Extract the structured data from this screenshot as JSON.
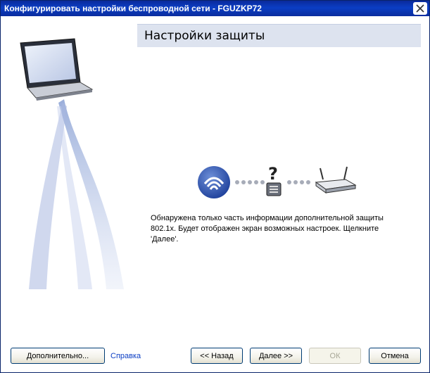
{
  "window": {
    "title": "Конфигурировать настройки беспроводной сети - FGUZKP72"
  },
  "header": {
    "title": "Настройки защиты"
  },
  "message": {
    "text": "Обнаружена только часть информации дополнительной защиты 802.1x. Будет отображен экран возможных настроек. Щелкните 'Далее'."
  },
  "buttons": {
    "advanced": "Дополнительно...",
    "help": "Справка",
    "back": "<< Назад",
    "next": "Далее >>",
    "ok": "ОК",
    "cancel": "Отмена"
  },
  "icons": {
    "close": "close-icon",
    "laptop": "laptop-icon",
    "wireless": "wireless-icon",
    "lock_question": "unknown-security-icon",
    "router": "router-icon"
  },
  "colors": {
    "titlebar": "#0a2a9c",
    "header_band": "#dde3ef",
    "link": "#0b3ec4",
    "close_x": "#c0392b"
  }
}
